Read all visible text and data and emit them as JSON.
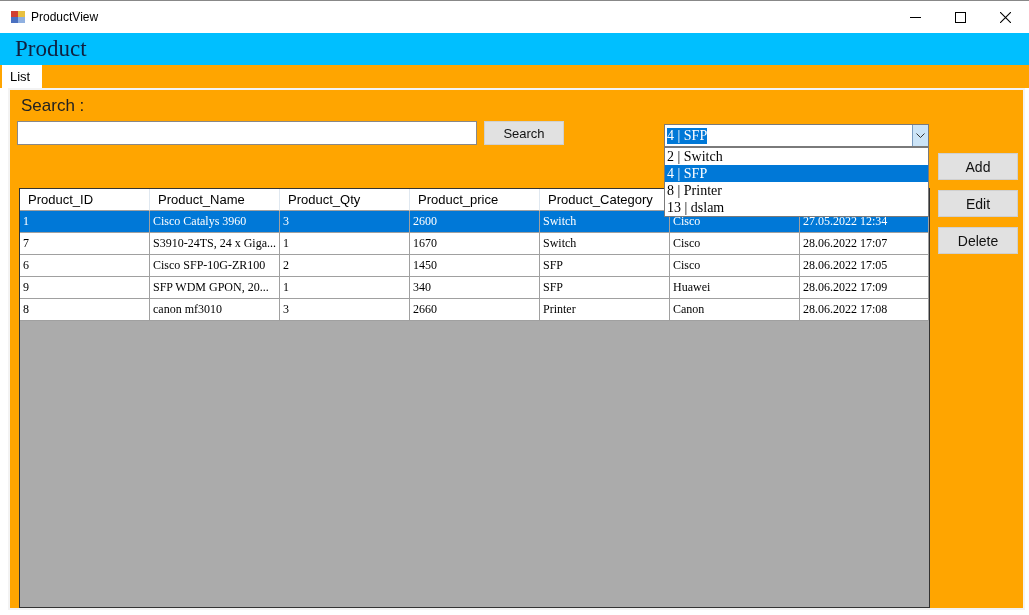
{
  "window": {
    "title": "ProductView"
  },
  "header": {
    "title": "Product"
  },
  "tabs": [
    {
      "label": "List",
      "selected": true
    }
  ],
  "search": {
    "label": "Search :",
    "button": "Search"
  },
  "category_combo": {
    "value": "4 | SFP",
    "expanded": true,
    "options": [
      {
        "label": "2 | Switch",
        "selected": false
      },
      {
        "label": "4 | SFP",
        "selected": true
      },
      {
        "label": "8 | Printer",
        "selected": false
      },
      {
        "label": "13 | dslam",
        "selected": false
      }
    ]
  },
  "buttons": [
    "Add",
    "Edit",
    "Delete"
  ],
  "table": {
    "columns": [
      "Product_ID",
      "Product_Name",
      "Product_Qty",
      "Product_price",
      "Product_Category"
    ],
    "rows": [
      {
        "selected": true,
        "cells": [
          "1",
          "Cisco Catalys 3960",
          "3",
          "2600",
          "Switch",
          "Cisco",
          "27.05.2022 12:34"
        ]
      },
      {
        "selected": false,
        "cells": [
          "7",
          "S3910-24TS, 24 x Giga...",
          "1",
          "1670",
          "Switch",
          "Cisco",
          "28.06.2022 17:07"
        ]
      },
      {
        "selected": false,
        "cells": [
          "6",
          "Cisco SFP-10G-ZR100",
          "2",
          "1450",
          "SFP",
          "Cisco",
          "28.06.2022 17:05"
        ]
      },
      {
        "selected": false,
        "cells": [
          "9",
          "SFP WDM GPON,  20...",
          "1",
          "340",
          "SFP",
          "Huawei",
          "28.06.2022 17:09"
        ]
      },
      {
        "selected": false,
        "cells": [
          "8",
          "canon mf3010",
          "3",
          "2660",
          "Printer",
          "Canon",
          "28.06.2022 17:08"
        ]
      }
    ]
  }
}
